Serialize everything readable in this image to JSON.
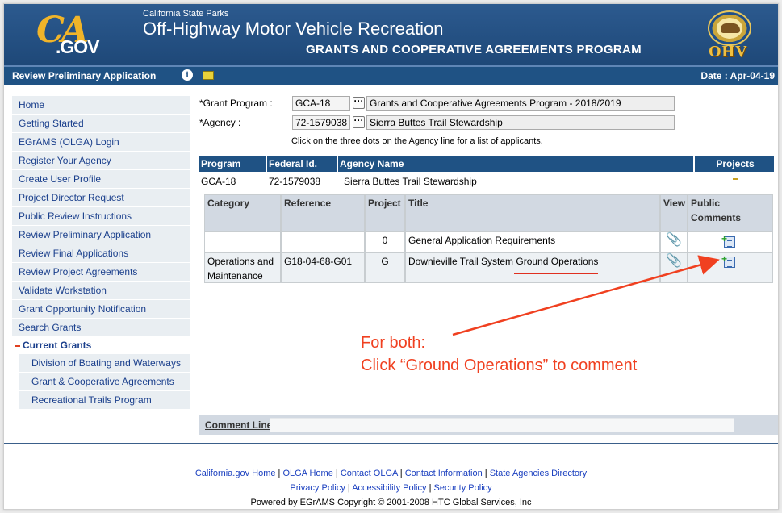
{
  "header": {
    "org": "California State Parks",
    "title": "Off-Highway Motor Vehicle Recreation",
    "program": "GRANTS AND COOPERATIVE AGREEMENTS PROGRAM",
    "logo_ca": "CA",
    "logo_gov": ".GOV",
    "badge": "OHV"
  },
  "subbar": {
    "page_name": "Review Preliminary Application",
    "date": "Date : Apr-04-19"
  },
  "sidebar": {
    "items": [
      {
        "label": "Home"
      },
      {
        "label": "Getting Started"
      },
      {
        "label": "EGrAMS (OLGA) Login"
      },
      {
        "label": "Register Your Agency"
      },
      {
        "label": "Create User Profile"
      },
      {
        "label": "Project Director Request"
      },
      {
        "label": "Public Review Instructions"
      },
      {
        "label": "Review Preliminary Application"
      },
      {
        "label": "Review Final Applications"
      },
      {
        "label": "Review Project Agreements"
      },
      {
        "label": "Validate Workstation"
      },
      {
        "label": "Grant Opportunity Notification"
      },
      {
        "label": "Search Grants"
      }
    ],
    "section": "Current Grants",
    "sub_items": [
      {
        "label": "Division of Boating and Waterways"
      },
      {
        "label": "Grant & Cooperative Agreements"
      },
      {
        "label": "Recreational Trails Program"
      }
    ]
  },
  "form": {
    "grant_program_label": "*Grant Program :",
    "grant_program_code": "GCA-18",
    "grant_program_name": "Grants and Cooperative Agreements Program - 2018/2019",
    "agency_label": "*Agency :",
    "agency_code": "72-1579038",
    "agency_name": "Sierra Buttes Trail Stewardship",
    "dots": "···",
    "hint": "Click on the three dots on the Agency line for a list of applicants."
  },
  "program_table": {
    "headers": {
      "program": "Program",
      "federal_id": "Federal Id.",
      "agency_name": "Agency Name",
      "projects": "Projects"
    },
    "row": {
      "program": "GCA-18",
      "federal_id": "72-1579038",
      "agency_name": "Sierra Buttes Trail Stewardship"
    }
  },
  "category_table": {
    "headers": {
      "category": "Category",
      "reference": "Reference",
      "project": "Project",
      "title": "Title",
      "view": "View",
      "public_comments": "Public Comments"
    },
    "rows": [
      {
        "category": "",
        "reference": "",
        "project": "0",
        "title": "General Application Requirements",
        "title_link": ""
      },
      {
        "category": "Operations and Maintenance",
        "reference": "G18-04-68-G01",
        "project": "G",
        "title": "Downieville Trail System ",
        "title_link": "Ground Operations"
      }
    ]
  },
  "annotation": {
    "line1": "For both:",
    "line2": "Click “Ground Operations” to comment"
  },
  "comment_line": {
    "label": "Comment Line:",
    "value": ""
  },
  "footer": {
    "links1": [
      "California.gov Home",
      "OLGA Home",
      "Contact OLGA",
      "Contact Information",
      "State Agencies Directory"
    ],
    "links2": [
      "Privacy Policy",
      "Accessibility Policy",
      "Security Policy"
    ],
    "powered": "Powered by EGrAMS Copyright © 2001-2008 HTC Global Services, Inc"
  },
  "colors": {
    "header_bg": "#1f5284",
    "accent_red": "#f04020",
    "link": "#1a3f8c"
  }
}
